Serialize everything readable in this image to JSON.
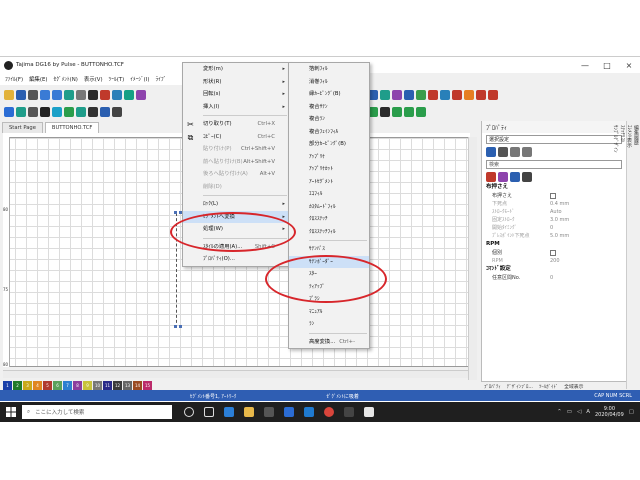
{
  "window": {
    "title": "Tajima DG16 by Pulse - BUTTONHO.TCF",
    "min_label": "—",
    "max_label": "□",
    "close_label": "×"
  },
  "menubar": [
    "ﾌｧｲﾙ(F)",
    "編集(E)",
    "ｾｸﾞﾒﾝﾄ(N)",
    "表示(V)",
    "ﾂｰﾙ(T)",
    "ｲﾒｰｼﾞ(I)",
    "ﾗｲﾌﾞ"
  ],
  "tabs": [
    "Start Page",
    "BUTTONHO.TCF"
  ],
  "ruler_left": [
    "80",
    "75",
    "80"
  ],
  "palette": [
    {
      "n": "1",
      "c": "#1a3fa8"
    },
    {
      "n": "2",
      "c": "#1f7a2a"
    },
    {
      "n": "3",
      "c": "#c9a81a"
    },
    {
      "n": "4",
      "c": "#e0861f"
    },
    {
      "n": "5",
      "c": "#b03a2e"
    },
    {
      "n": "6",
      "c": "#5aa15b"
    },
    {
      "n": "7",
      "c": "#2d7fd0"
    },
    {
      "n": "8",
      "c": "#8c3d9e"
    },
    {
      "n": "9",
      "c": "#c8c23a"
    },
    {
      "n": "10",
      "c": "#777777"
    },
    {
      "n": "11",
      "c": "#2a2a8a"
    },
    {
      "n": "12",
      "c": "#3b3b3b"
    },
    {
      "n": "13",
      "c": "#666666"
    },
    {
      "n": "14",
      "c": "#9a4a22"
    },
    {
      "n": "15",
      "c": "#bb2a6a"
    }
  ],
  "statusbar": {
    "left": "ｾｸﾞﾒﾝﾄ番号1, ｱｰﾄﾜｰｸ",
    "middle": "ｾﾞｸﾞﾒﾝﾄに吸着",
    "right": "CAP  NUM  SCRL"
  },
  "context_menu": {
    "items": [
      {
        "label": "変形(m)",
        "arrow": "▸",
        "icon": "",
        "sep_after": false,
        "disabled": false
      },
      {
        "label": "形状(R)",
        "arrow": "▸",
        "icon": "",
        "sep_after": false,
        "disabled": false
      },
      {
        "label": "回転(s)",
        "arrow": "▸",
        "icon": "",
        "sep_after": false,
        "disabled": false
      },
      {
        "label": "挿入(I)",
        "arrow": "▸",
        "icon": "",
        "sep_after": true,
        "disabled": false
      },
      {
        "label": "切り取り(T)",
        "shortcut": "Ctrl+X",
        "icon": "✂",
        "disabled": false
      },
      {
        "label": "ｺﾋﾟｰ(C)",
        "shortcut": "Ctrl+C",
        "icon": "⧉",
        "disabled": false
      },
      {
        "label": "貼り付け(P)",
        "shortcut": "Ctrl+Shift+V",
        "icon": "",
        "disabled": true
      },
      {
        "label": "前へ貼り付け(B)",
        "shortcut": "Alt+Shift+V",
        "icon": "",
        "disabled": true
      },
      {
        "label": "後ろへ貼り付け(A)",
        "shortcut": "Alt+V",
        "icon": "",
        "disabled": true
      },
      {
        "label": "削除(D)",
        "icon": "",
        "sep_after": true,
        "disabled": true
      },
      {
        "label": "ﾛｯｸ(L)",
        "arrow": "▸",
        "icon": "",
        "disabled": false
      },
      {
        "label": "ｾｸﾞﾒﾝﾄへ変換",
        "arrow": "▸",
        "icon": "",
        "disabled": false,
        "highlight": true
      },
      {
        "label": "処理(W)",
        "arrow": "▸",
        "icon": "",
        "sep_after": true,
        "disabled": false
      },
      {
        "label": "ｽﾀｲﾙの適用(A)...",
        "shortcut": "Shift+C",
        "icon": "",
        "disabled": false
      },
      {
        "label": "ﾌﾟﾛﾊﾟﾃｨ(O)...",
        "icon": "",
        "disabled": false
      }
    ]
  },
  "sub_menu": {
    "items": [
      {
        "label": "箔刺ﾌｨﾙ"
      },
      {
        "label": "消巻ﾌｨﾙ"
      },
      {
        "label": "縁ｶｰﾋﾟﾝｸﾞ(B)"
      },
      {
        "label": "複合ｻﾃﾝ"
      },
      {
        "label": "複合ﾗﾝ"
      },
      {
        "label": "複合ﾌｪｲﾝﾌｨﾙ"
      },
      {
        "label": "部分ｶｰﾋﾟﾝｸﾞ(B)"
      },
      {
        "label": "ｱｯﾌﾟﾘｹ"
      },
      {
        "label": "ｱｯﾌﾟﾘｹｶｯﾄ"
      },
      {
        "label": "ｱｰﾄｾｸﾞﾒﾝﾄ"
      },
      {
        "label": "ｴｺﾌｨﾙ"
      },
      {
        "label": "ｶｽﾀﾑｰﾄﾞﾌｨﾙ"
      },
      {
        "label": "ｸﾛｽｽﾃｯﾁ"
      },
      {
        "label": "ｸﾛｽｽﾃｯﾁﾌｨﾙ",
        "sep_after": true
      },
      {
        "label": "ｻﾃﾝﾊﾟｽ"
      },
      {
        "label": "ｻﾃﾝﾎﾞｰﾀﾞｰ",
        "highlight": true
      },
      {
        "label": "ｽﾀｰ"
      },
      {
        "label": "ﾃｨｱｯﾌﾟ"
      },
      {
        "label": "ﾌﾟﾗｼ"
      },
      {
        "label": "ﾏﾆｭｱﾙ"
      },
      {
        "label": "ﾗﾝ",
        "sep_after": true
      },
      {
        "label": "高度変換...",
        "shortcut": "Ctrl+-"
      }
    ]
  },
  "properties": {
    "header": "ﾌﾟﾛﾊﾟﾃｨ",
    "selected": "選択設定",
    "search_placeholder": "検索",
    "sections": [
      {
        "title": "布押さえ",
        "rows": [
          {
            "k": "布押さえ",
            "v": "",
            "check": true
          },
          {
            "k": "下死点",
            "v": "0.4 mm",
            "dim": true
          },
          {
            "k": "ｽﾄﾛｰｸﾓｰﾄﾞ",
            "v": "Auto",
            "dim": true
          },
          {
            "k": "固定ｽﾄﾛｰｸ",
            "v": "3.0 mm",
            "dim": true
          },
          {
            "k": "開始ﾀｲﾐﾝｸﾞ",
            "v": "0",
            "dim": true
          },
          {
            "k": "ﾌﾟﾚｽﾎﾟｲﾝﾄ下死点",
            "v": "5.0 mm",
            "dim": true
          }
        ]
      },
      {
        "title": "RPM",
        "rows": [
          {
            "k": "個別",
            "v": "",
            "check": true
          },
          {
            "k": "RPM",
            "v": "200",
            "dim": true
          }
        ]
      },
      {
        "title": "ｺﾏﾝﾄﾞ設定",
        "rows": [
          {
            "k": "任意区間No.",
            "v": "0",
            "dim": false
          }
        ]
      }
    ],
    "bottom_tabs": [
      "ﾌﾟﾛﾊﾟﾃｨ",
      "ﾃﾞｻﾞｲﾝﾌﾞﾛ...",
      "ﾂｰﾙｶﾞｲﾄﾞ",
      "全域表示"
    ],
    "side_tabs": [
      "編集履歴",
      "ｴﾚﾒﾝﾄ表示",
      "ｽﾃｯﾁﾘｽﾄ",
      "ｻﾝﾌﾟﾙﾃﾞｻﾞｲﾝ"
    ]
  },
  "taskbar": {
    "search_placeholder": "ここに入力して検索",
    "time": "9:00",
    "date": "2020/04/09",
    "lang": "A"
  },
  "colors": {
    "accent": "#2f5eb3",
    "highlight": "#cde0f7",
    "annotation_ring": "#d7262b"
  }
}
